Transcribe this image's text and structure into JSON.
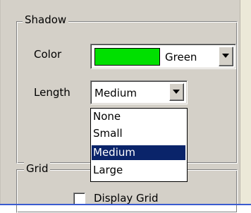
{
  "shadow": {
    "title": "Shadow",
    "color_label": "Color",
    "color_value": "Green",
    "color_swatch": "#00e000",
    "length_label": "Length",
    "length_value": "Medium",
    "options": [
      "None",
      "Small",
      "Medium",
      "Large"
    ],
    "selected_option": "Medium"
  },
  "grid": {
    "title": "Grid",
    "display_grid_label": "Display Grid"
  },
  "colors": {
    "panel": "#d4d0c8",
    "selection": "#0a246a"
  }
}
